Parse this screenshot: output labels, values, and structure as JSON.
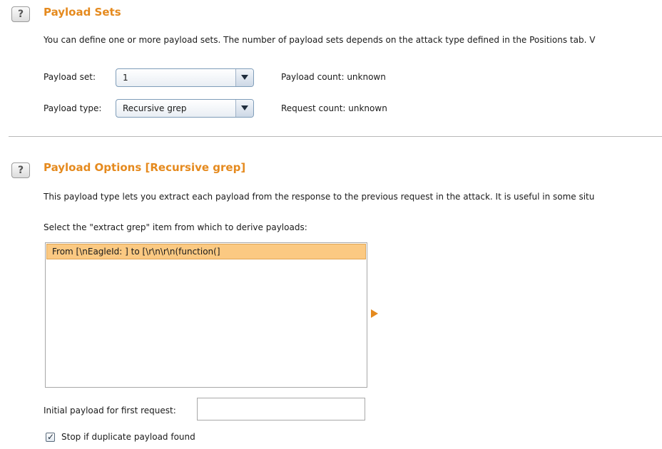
{
  "payload_sets": {
    "help_label": "?",
    "title": "Payload Sets",
    "description": "You can define one or more payload sets. The number of payload sets depends on the attack type defined in the Positions tab. V",
    "payload_set_label": "Payload set:",
    "payload_set_value": "1",
    "payload_type_label": "Payload type:",
    "payload_type_value": "Recursive grep",
    "payload_count": "Payload count:  unknown",
    "request_count": "Request count:  unknown"
  },
  "payload_options": {
    "help_label": "?",
    "title": "Payload Options [Recursive grep]",
    "description": "This payload type lets you extract each payload from the response to the previous request in the attack. It is useful in some situ",
    "select_label": "Select the \"extract grep\" item from which to derive payloads:",
    "grep_items": [
      "From [\\nEagleId: ] to [\\r\\n\\r\\n(function(]"
    ],
    "initial_payload_label": "Initial payload for first request:",
    "initial_payload_value": "",
    "stop_duplicate_label": "Stop if duplicate payload found",
    "stop_duplicate_checked": true
  },
  "icons": {
    "help": "help-icon",
    "dropdown": "chevron-down-icon",
    "play": "play-arrow-icon",
    "check": "checkmark-icon"
  },
  "colors": {
    "accent": "#e58a1e",
    "selection": "#fbc982"
  }
}
